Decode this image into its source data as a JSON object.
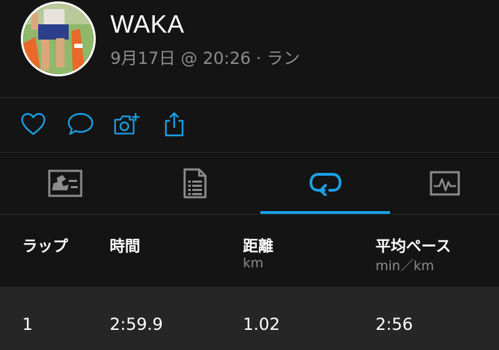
{
  "activity": {
    "user_name": "WAKA",
    "meta": "9月17日 @ 20:26 · ラン"
  },
  "actions": [
    {
      "name": "like",
      "icon": "heart-icon"
    },
    {
      "name": "comment",
      "icon": "comment-icon"
    },
    {
      "name": "add-photo",
      "icon": "camera-plus-icon"
    },
    {
      "name": "share",
      "icon": "share-icon"
    }
  ],
  "tabs": [
    {
      "name": "map",
      "icon": "map-icon",
      "active": false
    },
    {
      "name": "stats",
      "icon": "document-list-icon",
      "active": false
    },
    {
      "name": "laps",
      "icon": "laps-loop-icon",
      "active": true
    },
    {
      "name": "charts",
      "icon": "chart-icon",
      "active": false
    }
  ],
  "laps_table": {
    "headers": {
      "lap": "ラップ",
      "time": "時間",
      "distance": "距離",
      "distance_unit": "km",
      "pace": "平均ペース",
      "pace_unit": "min／km"
    },
    "rows": [
      {
        "lap": "1",
        "time": "2:59.9",
        "distance": "1.02",
        "pace": "2:56"
      }
    ]
  },
  "colors": {
    "background": "#141414",
    "row_background": "#262626",
    "accent": "#1aa0e6",
    "tab_icon_gray": "#8c8c8c",
    "secondary_text": "#8c8c8c"
  }
}
